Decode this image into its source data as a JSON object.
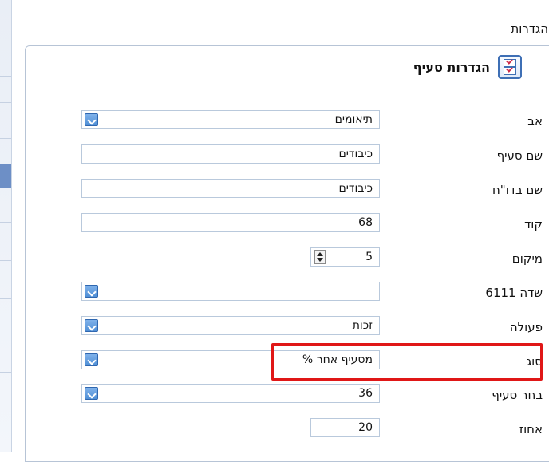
{
  "window": {
    "title": "הגדרות"
  },
  "panel": {
    "title": "הגדרות סעיף",
    "icon": "checklist-icon"
  },
  "form": {
    "rows": [
      {
        "label": "אב",
        "value": "תיאומים"
      },
      {
        "label": "שם סעיף",
        "value": "כיבודים"
      },
      {
        "label": "שם בדו\"ח",
        "value": "כיבודים"
      },
      {
        "label": "קוד",
        "value": "68"
      },
      {
        "label": "מיקום",
        "value": "5"
      },
      {
        "label": "שדה 6111",
        "value": ""
      },
      {
        "label": "פעולה",
        "value": "זכות"
      },
      {
        "label": "סוג",
        "value": "% מסעיף אחר"
      },
      {
        "label": "בחר סעיף",
        "value": "36"
      },
      {
        "label": "אחוז",
        "value": "20"
      }
    ]
  },
  "colors": {
    "highlight": "#e01717",
    "dropdown_button": "#4f8fd6",
    "field_border": "#b9c9dc"
  }
}
